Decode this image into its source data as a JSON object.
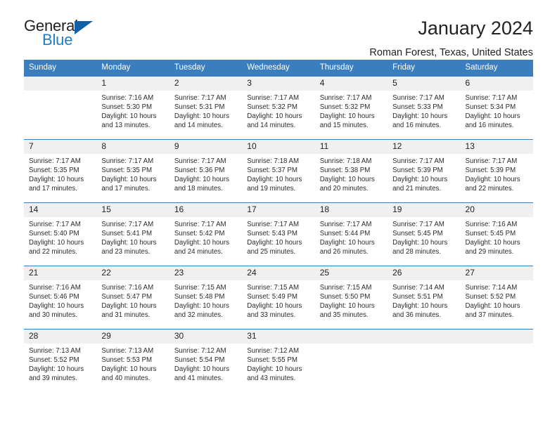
{
  "brand": {
    "name_top": "General",
    "name_bottom": "Blue",
    "triangle_color": "#1060a8",
    "blue_color": "#1f7dc4"
  },
  "header": {
    "title": "January 2024",
    "subtitle": "Roman Forest, Texas, United States"
  },
  "theme": {
    "header_bg": "#3a7ebf",
    "daynum_bg": "#f0f0f0",
    "row_border": "#3a7ebf"
  },
  "weekday_headers": [
    "Sunday",
    "Monday",
    "Tuesday",
    "Wednesday",
    "Thursday",
    "Friday",
    "Saturday"
  ],
  "labels": {
    "sunrise_prefix": "Sunrise: ",
    "sunset_prefix": "Sunset: ",
    "daylight_prefix": "Daylight: "
  },
  "weeks": [
    [
      {
        "day": "",
        "sunrise": "",
        "sunset": "",
        "daylight": ""
      },
      {
        "day": "1",
        "sunrise": "Sunrise: 7:16 AM",
        "sunset": "Sunset: 5:30 PM",
        "daylight": "Daylight: 10 hours and 13 minutes."
      },
      {
        "day": "2",
        "sunrise": "Sunrise: 7:17 AM",
        "sunset": "Sunset: 5:31 PM",
        "daylight": "Daylight: 10 hours and 14 minutes."
      },
      {
        "day": "3",
        "sunrise": "Sunrise: 7:17 AM",
        "sunset": "Sunset: 5:32 PM",
        "daylight": "Daylight: 10 hours and 14 minutes."
      },
      {
        "day": "4",
        "sunrise": "Sunrise: 7:17 AM",
        "sunset": "Sunset: 5:32 PM",
        "daylight": "Daylight: 10 hours and 15 minutes."
      },
      {
        "day": "5",
        "sunrise": "Sunrise: 7:17 AM",
        "sunset": "Sunset: 5:33 PM",
        "daylight": "Daylight: 10 hours and 16 minutes."
      },
      {
        "day": "6",
        "sunrise": "Sunrise: 7:17 AM",
        "sunset": "Sunset: 5:34 PM",
        "daylight": "Daylight: 10 hours and 16 minutes."
      }
    ],
    [
      {
        "day": "7",
        "sunrise": "Sunrise: 7:17 AM",
        "sunset": "Sunset: 5:35 PM",
        "daylight": "Daylight: 10 hours and 17 minutes."
      },
      {
        "day": "8",
        "sunrise": "Sunrise: 7:17 AM",
        "sunset": "Sunset: 5:35 PM",
        "daylight": "Daylight: 10 hours and 17 minutes."
      },
      {
        "day": "9",
        "sunrise": "Sunrise: 7:17 AM",
        "sunset": "Sunset: 5:36 PM",
        "daylight": "Daylight: 10 hours and 18 minutes."
      },
      {
        "day": "10",
        "sunrise": "Sunrise: 7:18 AM",
        "sunset": "Sunset: 5:37 PM",
        "daylight": "Daylight: 10 hours and 19 minutes."
      },
      {
        "day": "11",
        "sunrise": "Sunrise: 7:18 AM",
        "sunset": "Sunset: 5:38 PM",
        "daylight": "Daylight: 10 hours and 20 minutes."
      },
      {
        "day": "12",
        "sunrise": "Sunrise: 7:17 AM",
        "sunset": "Sunset: 5:39 PM",
        "daylight": "Daylight: 10 hours and 21 minutes."
      },
      {
        "day": "13",
        "sunrise": "Sunrise: 7:17 AM",
        "sunset": "Sunset: 5:39 PM",
        "daylight": "Daylight: 10 hours and 22 minutes."
      }
    ],
    [
      {
        "day": "14",
        "sunrise": "Sunrise: 7:17 AM",
        "sunset": "Sunset: 5:40 PM",
        "daylight": "Daylight: 10 hours and 22 minutes."
      },
      {
        "day": "15",
        "sunrise": "Sunrise: 7:17 AM",
        "sunset": "Sunset: 5:41 PM",
        "daylight": "Daylight: 10 hours and 23 minutes."
      },
      {
        "day": "16",
        "sunrise": "Sunrise: 7:17 AM",
        "sunset": "Sunset: 5:42 PM",
        "daylight": "Daylight: 10 hours and 24 minutes."
      },
      {
        "day": "17",
        "sunrise": "Sunrise: 7:17 AM",
        "sunset": "Sunset: 5:43 PM",
        "daylight": "Daylight: 10 hours and 25 minutes."
      },
      {
        "day": "18",
        "sunrise": "Sunrise: 7:17 AM",
        "sunset": "Sunset: 5:44 PM",
        "daylight": "Daylight: 10 hours and 26 minutes."
      },
      {
        "day": "19",
        "sunrise": "Sunrise: 7:17 AM",
        "sunset": "Sunset: 5:45 PM",
        "daylight": "Daylight: 10 hours and 28 minutes."
      },
      {
        "day": "20",
        "sunrise": "Sunrise: 7:16 AM",
        "sunset": "Sunset: 5:45 PM",
        "daylight": "Daylight: 10 hours and 29 minutes."
      }
    ],
    [
      {
        "day": "21",
        "sunrise": "Sunrise: 7:16 AM",
        "sunset": "Sunset: 5:46 PM",
        "daylight": "Daylight: 10 hours and 30 minutes."
      },
      {
        "day": "22",
        "sunrise": "Sunrise: 7:16 AM",
        "sunset": "Sunset: 5:47 PM",
        "daylight": "Daylight: 10 hours and 31 minutes."
      },
      {
        "day": "23",
        "sunrise": "Sunrise: 7:15 AM",
        "sunset": "Sunset: 5:48 PM",
        "daylight": "Daylight: 10 hours and 32 minutes."
      },
      {
        "day": "24",
        "sunrise": "Sunrise: 7:15 AM",
        "sunset": "Sunset: 5:49 PM",
        "daylight": "Daylight: 10 hours and 33 minutes."
      },
      {
        "day": "25",
        "sunrise": "Sunrise: 7:15 AM",
        "sunset": "Sunset: 5:50 PM",
        "daylight": "Daylight: 10 hours and 35 minutes."
      },
      {
        "day": "26",
        "sunrise": "Sunrise: 7:14 AM",
        "sunset": "Sunset: 5:51 PM",
        "daylight": "Daylight: 10 hours and 36 minutes."
      },
      {
        "day": "27",
        "sunrise": "Sunrise: 7:14 AM",
        "sunset": "Sunset: 5:52 PM",
        "daylight": "Daylight: 10 hours and 37 minutes."
      }
    ],
    [
      {
        "day": "28",
        "sunrise": "Sunrise: 7:13 AM",
        "sunset": "Sunset: 5:52 PM",
        "daylight": "Daylight: 10 hours and 39 minutes."
      },
      {
        "day": "29",
        "sunrise": "Sunrise: 7:13 AM",
        "sunset": "Sunset: 5:53 PM",
        "daylight": "Daylight: 10 hours and 40 minutes."
      },
      {
        "day": "30",
        "sunrise": "Sunrise: 7:12 AM",
        "sunset": "Sunset: 5:54 PM",
        "daylight": "Daylight: 10 hours and 41 minutes."
      },
      {
        "day": "31",
        "sunrise": "Sunrise: 7:12 AM",
        "sunset": "Sunset: 5:55 PM",
        "daylight": "Daylight: 10 hours and 43 minutes."
      },
      {
        "day": "",
        "sunrise": "",
        "sunset": "",
        "daylight": ""
      },
      {
        "day": "",
        "sunrise": "",
        "sunset": "",
        "daylight": ""
      },
      {
        "day": "",
        "sunrise": "",
        "sunset": "",
        "daylight": ""
      }
    ]
  ]
}
